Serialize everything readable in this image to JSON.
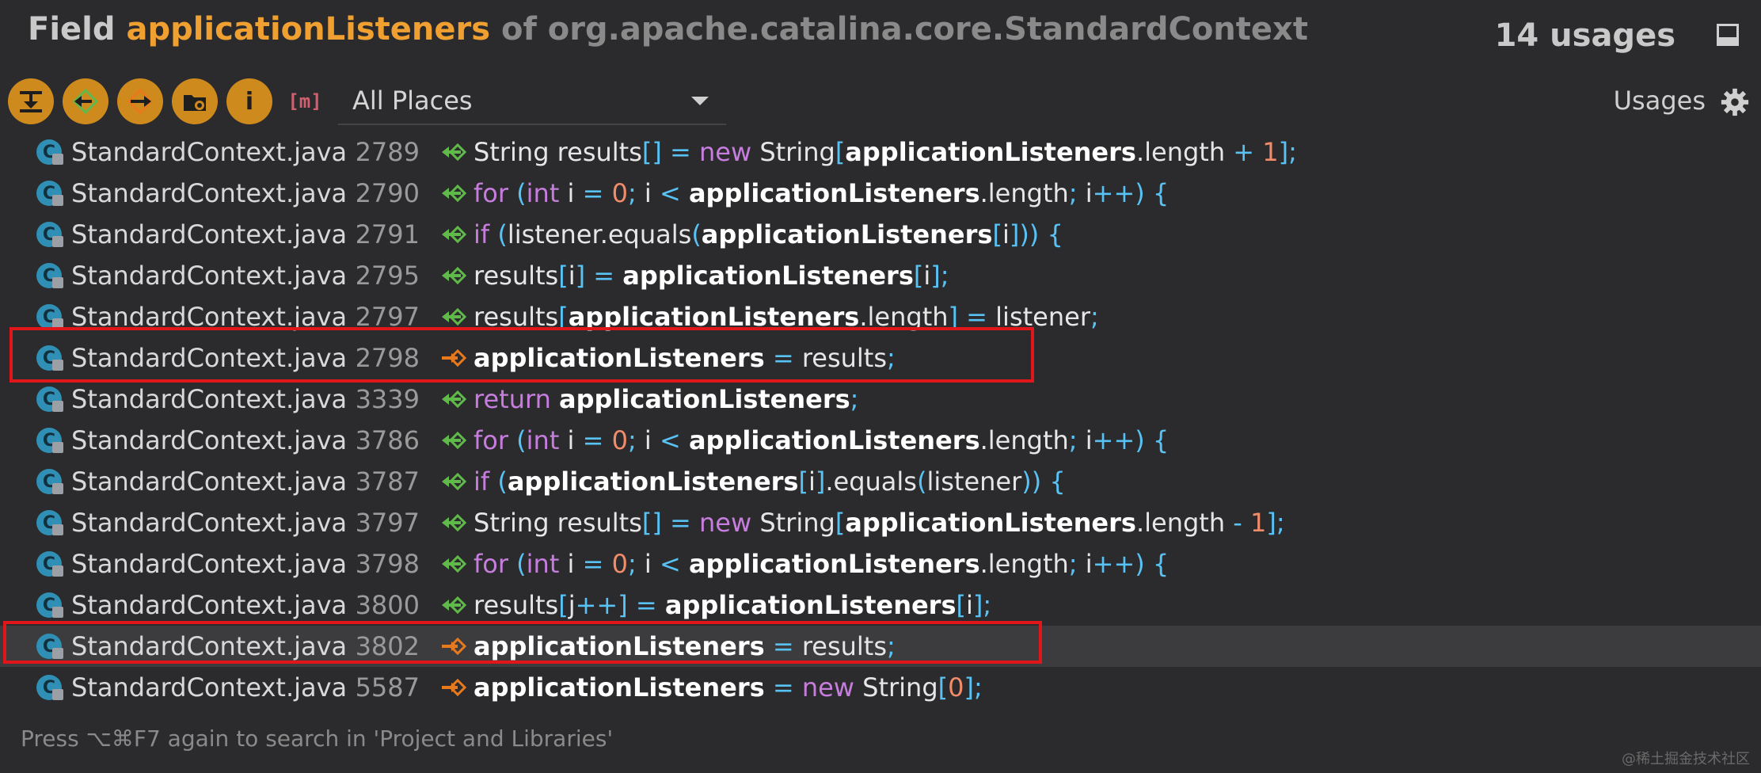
{
  "header": {
    "prefix": "Field",
    "field_name": "applicationListeners",
    "suffix": "of org.apache.catalina.core.StandardContext",
    "usage_count": "14 usages"
  },
  "toolbar": {
    "scope_value": "All Places",
    "usages_label": "Usages",
    "info_glyph": "i",
    "m_glyph": "m",
    "icons": [
      "expand-all-icon",
      "previous-occurrence-icon",
      "next-occurrence-icon",
      "group-by-file-icon",
      "info-icon",
      "method-filter-icon"
    ]
  },
  "rows": [
    {
      "file": "StandardContext.java",
      "line": "2789",
      "type": "read"
    },
    {
      "file": "StandardContext.java",
      "line": "2790",
      "type": "read"
    },
    {
      "file": "StandardContext.java",
      "line": "2791",
      "type": "read"
    },
    {
      "file": "StandardContext.java",
      "line": "2795",
      "type": "read"
    },
    {
      "file": "StandardContext.java",
      "line": "2797",
      "type": "read"
    },
    {
      "file": "StandardContext.java",
      "line": "2798",
      "type": "write",
      "highlighted": true
    },
    {
      "file": "StandardContext.java",
      "line": "3339",
      "type": "read"
    },
    {
      "file": "StandardContext.java",
      "line": "3786",
      "type": "read"
    },
    {
      "file": "StandardContext.java",
      "line": "3787",
      "type": "read"
    },
    {
      "file": "StandardContext.java",
      "line": "3797",
      "type": "read"
    },
    {
      "file": "StandardContext.java",
      "line": "3798",
      "type": "read"
    },
    {
      "file": "StandardContext.java",
      "line": "3800",
      "type": "read"
    },
    {
      "file": "StandardContext.java",
      "line": "3802",
      "type": "write",
      "highlighted": true,
      "selected": true
    },
    {
      "file": "StandardContext.java",
      "line": "5587",
      "type": "write"
    }
  ],
  "code": [
    [
      {
        "t": "String results"
      },
      {
        "t": "[]",
        "c": "pun"
      },
      {
        "t": " "
      },
      {
        "t": "=",
        "c": "pun"
      },
      {
        "t": " "
      },
      {
        "t": "new",
        "c": "kw"
      },
      {
        "t": " String"
      },
      {
        "t": "[",
        "c": "pun"
      },
      {
        "t": "applicationListeners",
        "c": "bold"
      },
      {
        "t": ".length "
      },
      {
        "t": "+",
        "c": "pun"
      },
      {
        "t": " "
      },
      {
        "t": "1",
        "c": "num"
      },
      {
        "t": "];",
        "c": "pun"
      }
    ],
    [
      {
        "t": "for",
        "c": "kw"
      },
      {
        "t": " "
      },
      {
        "t": "(",
        "c": "pun"
      },
      {
        "t": "int",
        "c": "kw"
      },
      {
        "t": " i "
      },
      {
        "t": "=",
        "c": "pun"
      },
      {
        "t": " "
      },
      {
        "t": "0",
        "c": "num"
      },
      {
        "t": ";",
        "c": "pun"
      },
      {
        "t": " i "
      },
      {
        "t": "<",
        "c": "pun"
      },
      {
        "t": " "
      },
      {
        "t": "applicationListeners",
        "c": "bold"
      },
      {
        "t": ".length"
      },
      {
        "t": ";",
        "c": "pun"
      },
      {
        "t": " i"
      },
      {
        "t": "++) {",
        "c": "pun"
      }
    ],
    [
      {
        "t": "if",
        "c": "kw"
      },
      {
        "t": " "
      },
      {
        "t": "(",
        "c": "pun"
      },
      {
        "t": "listener.equals"
      },
      {
        "t": "(",
        "c": "pun"
      },
      {
        "t": "applicationListeners",
        "c": "bold"
      },
      {
        "t": "[",
        "c": "pun"
      },
      {
        "t": "i"
      },
      {
        "t": "])) {",
        "c": "pun"
      }
    ],
    [
      {
        "t": "results"
      },
      {
        "t": "[",
        "c": "pun"
      },
      {
        "t": "i"
      },
      {
        "t": "]",
        "c": "pun"
      },
      {
        "t": " "
      },
      {
        "t": "=",
        "c": "pun"
      },
      {
        "t": " "
      },
      {
        "t": "applicationListeners",
        "c": "bold"
      },
      {
        "t": "[",
        "c": "pun"
      },
      {
        "t": "i"
      },
      {
        "t": "];",
        "c": "pun"
      }
    ],
    [
      {
        "t": "results"
      },
      {
        "t": "[",
        "c": "pun"
      },
      {
        "t": "applicationListeners",
        "c": "bold"
      },
      {
        "t": ".length"
      },
      {
        "t": "]",
        "c": "pun"
      },
      {
        "t": " "
      },
      {
        "t": "=",
        "c": "pun"
      },
      {
        "t": " listener"
      },
      {
        "t": ";",
        "c": "pun"
      }
    ],
    [
      {
        "t": "applicationListeners",
        "c": "bold"
      },
      {
        "t": " "
      },
      {
        "t": "=",
        "c": "pun"
      },
      {
        "t": " results"
      },
      {
        "t": ";",
        "c": "pun"
      }
    ],
    [
      {
        "t": "return",
        "c": "kw"
      },
      {
        "t": " "
      },
      {
        "t": "applicationListeners",
        "c": "bold"
      },
      {
        "t": ";",
        "c": "pun"
      }
    ],
    [
      {
        "t": "for",
        "c": "kw"
      },
      {
        "t": " "
      },
      {
        "t": "(",
        "c": "pun"
      },
      {
        "t": "int",
        "c": "kw"
      },
      {
        "t": " i "
      },
      {
        "t": "=",
        "c": "pun"
      },
      {
        "t": " "
      },
      {
        "t": "0",
        "c": "num"
      },
      {
        "t": ";",
        "c": "pun"
      },
      {
        "t": " i "
      },
      {
        "t": "<",
        "c": "pun"
      },
      {
        "t": " "
      },
      {
        "t": "applicationListeners",
        "c": "bold"
      },
      {
        "t": ".length"
      },
      {
        "t": ";",
        "c": "pun"
      },
      {
        "t": " i"
      },
      {
        "t": "++) {",
        "c": "pun"
      }
    ],
    [
      {
        "t": "if",
        "c": "kw"
      },
      {
        "t": " "
      },
      {
        "t": "(",
        "c": "pun"
      },
      {
        "t": "applicationListeners",
        "c": "bold"
      },
      {
        "t": "[",
        "c": "pun"
      },
      {
        "t": "i"
      },
      {
        "t": "]",
        "c": "pun"
      },
      {
        "t": ".equals"
      },
      {
        "t": "(",
        "c": "pun"
      },
      {
        "t": "listener"
      },
      {
        "t": ")) {",
        "c": "pun"
      }
    ],
    [
      {
        "t": "String results"
      },
      {
        "t": "[]",
        "c": "pun"
      },
      {
        "t": " "
      },
      {
        "t": "=",
        "c": "pun"
      },
      {
        "t": " "
      },
      {
        "t": "new",
        "c": "kw"
      },
      {
        "t": " String"
      },
      {
        "t": "[",
        "c": "pun"
      },
      {
        "t": "applicationListeners",
        "c": "bold"
      },
      {
        "t": ".length "
      },
      {
        "t": "-",
        "c": "pun"
      },
      {
        "t": " "
      },
      {
        "t": "1",
        "c": "num"
      },
      {
        "t": "];",
        "c": "pun"
      }
    ],
    [
      {
        "t": "for",
        "c": "kw"
      },
      {
        "t": " "
      },
      {
        "t": "(",
        "c": "pun"
      },
      {
        "t": "int",
        "c": "kw"
      },
      {
        "t": " i "
      },
      {
        "t": "=",
        "c": "pun"
      },
      {
        "t": " "
      },
      {
        "t": "0",
        "c": "num"
      },
      {
        "t": ";",
        "c": "pun"
      },
      {
        "t": " i "
      },
      {
        "t": "<",
        "c": "pun"
      },
      {
        "t": " "
      },
      {
        "t": "applicationListeners",
        "c": "bold"
      },
      {
        "t": ".length"
      },
      {
        "t": ";",
        "c": "pun"
      },
      {
        "t": " i"
      },
      {
        "t": "++) {",
        "c": "pun"
      }
    ],
    [
      {
        "t": "results"
      },
      {
        "t": "[",
        "c": "pun"
      },
      {
        "t": "j"
      },
      {
        "t": "++]",
        "c": "pun"
      },
      {
        "t": " "
      },
      {
        "t": "=",
        "c": "pun"
      },
      {
        "t": " "
      },
      {
        "t": "applicationListeners",
        "c": "bold"
      },
      {
        "t": "[",
        "c": "pun"
      },
      {
        "t": "i"
      },
      {
        "t": "];",
        "c": "pun"
      }
    ],
    [
      {
        "t": "applicationListeners",
        "c": "bold"
      },
      {
        "t": " "
      },
      {
        "t": "=",
        "c": "pun"
      },
      {
        "t": " results"
      },
      {
        "t": ";",
        "c": "pun"
      }
    ],
    [
      {
        "t": "applicationListeners",
        "c": "bold"
      },
      {
        "t": " "
      },
      {
        "t": "=",
        "c": "pun"
      },
      {
        "t": " "
      },
      {
        "t": "new",
        "c": "kw"
      },
      {
        "t": " String"
      },
      {
        "t": "[",
        "c": "pun"
      },
      {
        "t": "0",
        "c": "num"
      },
      {
        "t": "];",
        "c": "pun"
      }
    ]
  ],
  "footer": "Press ⌥⌘F7 again to search in 'Project and Libraries'",
  "watermark": "@稀土掘金技术社区",
  "colors": {
    "read_arrow": "#5fba4a",
    "write_arrow": "#e8791c",
    "highlight_box": "#e0161b"
  }
}
